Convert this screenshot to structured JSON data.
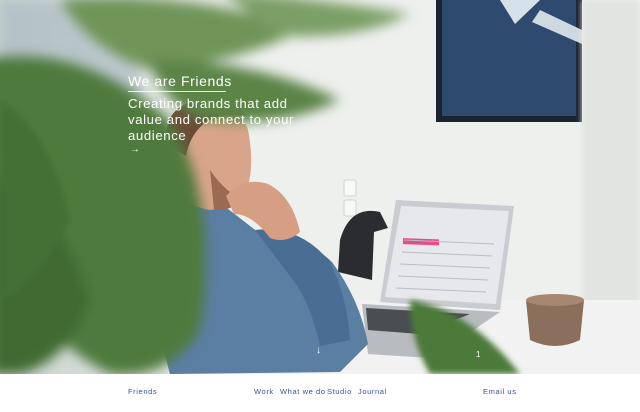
{
  "hero": {
    "eyebrow": "We are Friends",
    "headline": "Creating brands that add value and connect to your audience",
    "arrow_icon": "→",
    "scroll_icon": "↓",
    "slide_counter": "1"
  },
  "nav": {
    "brand": "Friends",
    "items": [
      "Work",
      "What we do",
      "Studio",
      "Journal"
    ],
    "contact": "Email us"
  },
  "colors": {
    "nav_text": "#3c4fa0",
    "hero_text": "#ffffff",
    "laptop_highlight": "#e84a8a",
    "plant": "#4f7a3c"
  },
  "icons": {
    "hero_arrow": "arrow-right-icon",
    "scroll": "arrow-down-icon"
  }
}
